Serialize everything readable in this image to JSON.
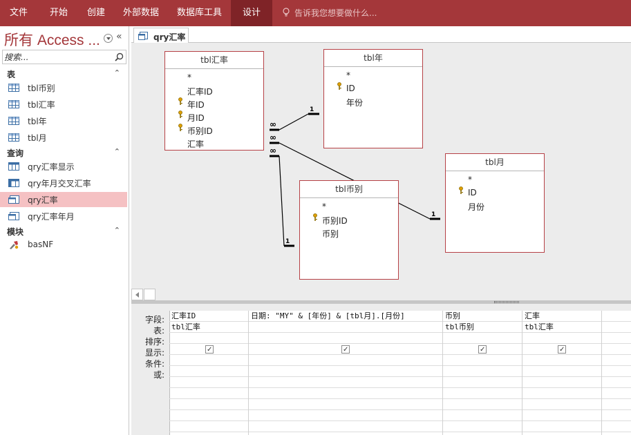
{
  "ribbon": {
    "tabs": [
      "文件",
      "开始",
      "创建",
      "外部数据",
      "数据库工具",
      "设计"
    ],
    "active_tab": "设计",
    "tell_me": "告诉我您想要做什么..."
  },
  "nav": {
    "title": "所有 Access ...",
    "collapse": "«",
    "search_placeholder": "搜索...",
    "groups": [
      {
        "label": "表",
        "items": [
          "tbl币别",
          "tbl汇率",
          "tbl年",
          "tbl月"
        ]
      },
      {
        "label": "查询",
        "items": [
          "qry汇率显示",
          "qry年月交叉汇率",
          "qry汇率",
          "qry汇率年月"
        ],
        "selected": "qry汇率"
      },
      {
        "label": "模块",
        "items": [
          "basNF"
        ]
      }
    ],
    "chevron": "⌃"
  },
  "document": {
    "tab_label": "qry汇率"
  },
  "field_lists": {
    "huilv": {
      "title": "tbl汇率",
      "fields": [
        "*",
        "汇率ID",
        "年ID",
        "月ID",
        "币别ID",
        "汇率"
      ]
    },
    "nian": {
      "title": "tbl年",
      "fields": [
        "*",
        "ID",
        "年份"
      ]
    },
    "yue": {
      "title": "tbl月",
      "fields": [
        "*",
        "ID",
        "月份"
      ]
    },
    "bibie": {
      "title": "tbl币别",
      "fields": [
        "*",
        "币别ID",
        "币别"
      ]
    }
  },
  "relationships": {
    "one": "1",
    "many": "∞"
  },
  "qbe": {
    "row_labels": [
      "字段:",
      "表:",
      "排序:",
      "显示:",
      "条件:",
      "或:"
    ],
    "columns": [
      {
        "field": "汇率ID",
        "table": "tbl汇率",
        "show": true
      },
      {
        "field": "日期: \"MY\" & [年份] & [tbl月].[月份]",
        "table": "",
        "show": true
      },
      {
        "field": "币别",
        "table": "tbl币别",
        "show": true
      },
      {
        "field": "汇率",
        "table": "tbl汇率",
        "show": true
      }
    ]
  }
}
